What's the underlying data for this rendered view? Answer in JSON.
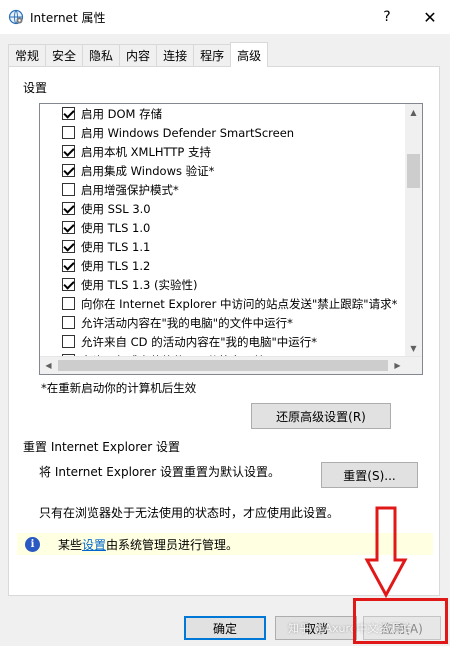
{
  "window": {
    "title": "Internet 属性",
    "help": "?",
    "close": "✕"
  },
  "tabs": [
    {
      "label": "常规"
    },
    {
      "label": "安全"
    },
    {
      "label": "隐私"
    },
    {
      "label": "内容"
    },
    {
      "label": "连接"
    },
    {
      "label": "程序"
    },
    {
      "label": "高级",
      "active": true
    }
  ],
  "settings": {
    "label": "设置",
    "items": [
      {
        "label": "启用 DOM 存储",
        "checked": true
      },
      {
        "label": "启用 Windows Defender SmartScreen",
        "checked": false
      },
      {
        "label": "启用本机 XMLHTTP 支持",
        "checked": true
      },
      {
        "label": "启用集成 Windows 验证*",
        "checked": true
      },
      {
        "label": "启用增强保护模式*",
        "checked": false
      },
      {
        "label": "使用 SSL 3.0",
        "checked": true
      },
      {
        "label": "使用 TLS 1.0",
        "checked": true
      },
      {
        "label": "使用 TLS 1.1",
        "checked": true
      },
      {
        "label": "使用 TLS 1.2",
        "checked": true
      },
      {
        "label": "使用 TLS 1.3 (实验性)",
        "checked": true
      },
      {
        "label": "向你在 Internet Explorer 中访问的站点发送\"禁止跟踪\"请求*",
        "checked": false
      },
      {
        "label": "允许活动内容在\"我的电脑\"的文件中运行*",
        "checked": false
      },
      {
        "label": "允许来自 CD 的活动内容在\"我的电脑\"中运行*",
        "checked": false
      },
      {
        "label": "允许运行或安装软件，即使签名无效",
        "checked": false
      }
    ],
    "note": "*在重新启动你的计算机后生效",
    "restore_button": "还原高级设置(R)"
  },
  "reset": {
    "title": "重置 Internet Explorer 设置",
    "description": "将 Internet Explorer 设置重置为默认设置。",
    "button": "重置(S)...",
    "warning": "只有在浏览器处于无法使用的状态时，才应使用此设置。"
  },
  "info": {
    "prefix": "某些",
    "link": "设置",
    "suffix": "由系统管理员进行管理。"
  },
  "buttons": {
    "ok": "确定",
    "cancel": "取消",
    "apply": "应用(A)"
  },
  "watermark": "知乎 @Axure中文资源站",
  "colors": {
    "annotation": "#e01818",
    "link": "#0066cc",
    "info_bg": "#ffffe1",
    "focus": "#0078d7"
  }
}
